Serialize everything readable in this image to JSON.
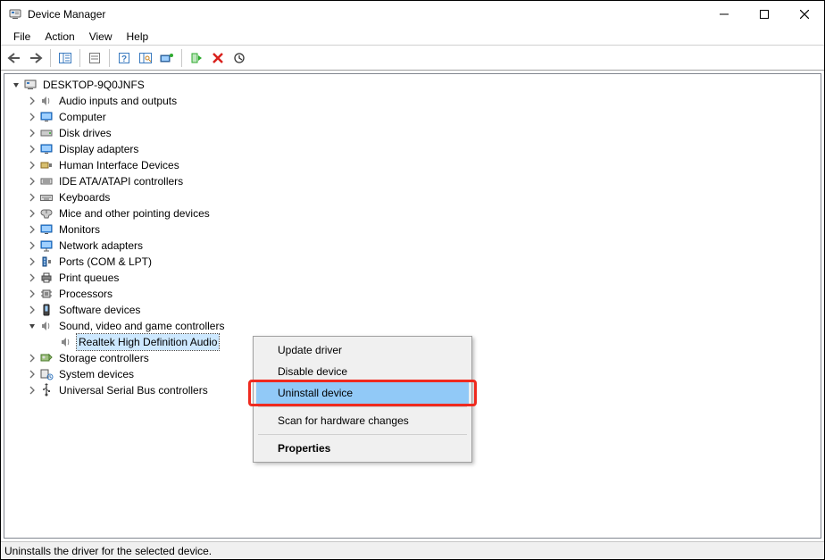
{
  "window": {
    "title": "Device Manager"
  },
  "menu": {
    "file": "File",
    "action": "Action",
    "view": "View",
    "help": "Help"
  },
  "tree": {
    "root": "DESKTOP-9Q0JNFS",
    "categories": [
      {
        "id": "audio",
        "label": "Audio inputs and outputs",
        "icon": "speaker"
      },
      {
        "id": "computer",
        "label": "Computer",
        "icon": "monitor"
      },
      {
        "id": "disk",
        "label": "Disk drives",
        "icon": "drive"
      },
      {
        "id": "display",
        "label": "Display adapters",
        "icon": "monitor"
      },
      {
        "id": "hid",
        "label": "Human Interface Devices",
        "icon": "hid"
      },
      {
        "id": "ide",
        "label": "IDE ATA/ATAPI controllers",
        "icon": "ide"
      },
      {
        "id": "keyboards",
        "label": "Keyboards",
        "icon": "keyboard"
      },
      {
        "id": "mouse",
        "label": "Mice and other pointing devices",
        "icon": "mouse"
      },
      {
        "id": "monitors",
        "label": "Monitors",
        "icon": "monitor"
      },
      {
        "id": "network",
        "label": "Network adapters",
        "icon": "network"
      },
      {
        "id": "ports",
        "label": "Ports (COM & LPT)",
        "icon": "port"
      },
      {
        "id": "printq",
        "label": "Print queues",
        "icon": "printer"
      },
      {
        "id": "processors",
        "label": "Processors",
        "icon": "cpu"
      },
      {
        "id": "software",
        "label": "Software devices",
        "icon": "software"
      },
      {
        "id": "svg",
        "label": "Sound, video and game controllers",
        "icon": "speaker"
      },
      {
        "id": "storagectrl",
        "label": "Storage controllers",
        "icon": "storage"
      },
      {
        "id": "system",
        "label": "System devices",
        "icon": "system"
      },
      {
        "id": "usb",
        "label": "Universal Serial Bus controllers",
        "icon": "usb"
      }
    ],
    "expanded_category_id": "svg",
    "expanded_child": {
      "id": "realtek",
      "label": "Realtek High Definition Audio",
      "icon": "speaker",
      "selected": true
    }
  },
  "context_menu": {
    "items": [
      {
        "id": "update",
        "label": "Update driver"
      },
      {
        "id": "disable",
        "label": "Disable device"
      },
      {
        "id": "uninstall",
        "label": "Uninstall device",
        "highlighted": true
      },
      {
        "separator": true
      },
      {
        "id": "scan",
        "label": "Scan for hardware changes"
      },
      {
        "separator": true
      },
      {
        "id": "props",
        "label": "Properties",
        "bold": true
      }
    ]
  },
  "statusbar": {
    "text": "Uninstalls the driver for the selected device."
  }
}
